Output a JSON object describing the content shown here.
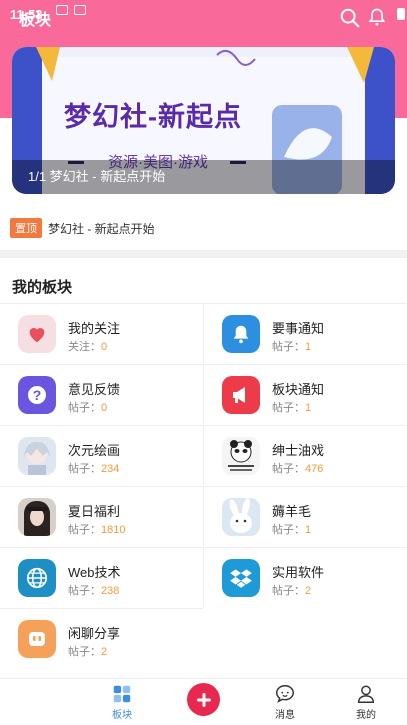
{
  "status_bar": {
    "time": "11:53"
  },
  "header": {
    "title": "板块"
  },
  "banner": {
    "caption": "1/1 梦幻社 - 新起点开始",
    "art_title": "梦幻社-新起点",
    "art_subtitle": "资源·美图·游戏"
  },
  "pinned": {
    "tag": "置顶",
    "text": "梦幻社 - 新起点开始"
  },
  "section": {
    "title": "我的板块"
  },
  "boards": [
    {
      "name": "我的关注",
      "stat_label": "关注：",
      "stat_value": "0",
      "icon": "heart-icon",
      "color": "#f6dfe2"
    },
    {
      "name": "要事通知",
      "stat_label": "帖子：",
      "stat_value": "1",
      "icon": "bell-icon",
      "color": "#2c8fe0"
    },
    {
      "name": "意见反馈",
      "stat_label": "帖子：",
      "stat_value": "0",
      "icon": "question-icon",
      "color": "#6a55e0"
    },
    {
      "name": "板块通知",
      "stat_label": "帖子：",
      "stat_value": "1",
      "icon": "megaphone-icon",
      "color": "#ee3b49"
    },
    {
      "name": "次元绘画",
      "stat_label": "帖子：",
      "stat_value": "234",
      "icon": "anime-girl-avatar",
      "color": "#dfe6f0"
    },
    {
      "name": "绅士油戏",
      "stat_label": "帖子：",
      "stat_value": "476",
      "icon": "meme-panda-avatar",
      "color": "#efefef"
    },
    {
      "name": "夏日福利",
      "stat_label": "帖子：",
      "stat_value": "1810",
      "icon": "girl-photo-avatar",
      "color": "#d6cfca"
    },
    {
      "name": "薅羊毛",
      "stat_label": "帖子：",
      "stat_value": "1",
      "icon": "bunny-avatar",
      "color": "#dbe7f3"
    },
    {
      "name": "Web技术",
      "stat_label": "帖子：",
      "stat_value": "238",
      "icon": "globe-icon",
      "color": "#1e8fc4"
    },
    {
      "name": "实用软件",
      "stat_label": "帖子：",
      "stat_value": "2",
      "icon": "dropbox-icon",
      "color": "#1e9ad6"
    },
    {
      "name": "闲聊分享",
      "stat_label": "帖子：",
      "stat_value": "2",
      "icon": "chat-robot-icon",
      "color": "#f5a15a"
    }
  ],
  "tabbar": {
    "tabs": [
      {
        "label": "板块",
        "icon": "grid-icon",
        "active": true
      },
      {
        "label": "消息",
        "icon": "message-icon",
        "active": false
      },
      {
        "label": "我的",
        "icon": "user-icon",
        "active": false
      }
    ],
    "fab_icon": "plus-icon"
  },
  "colors": {
    "header": "#f96a9b",
    "accent_blue": "#3b8ee0",
    "stat_orange": "#f29a3c",
    "fab_red": "#e8284f",
    "pin_tag": "#f37a3f"
  }
}
